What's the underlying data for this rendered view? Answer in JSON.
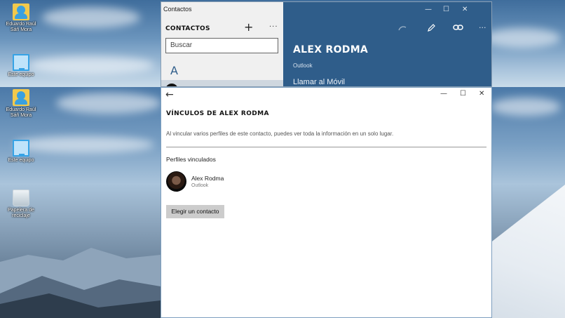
{
  "desktop": {
    "icons_top": [
      {
        "label": "Eduardo Raúl Sáñ Mora",
        "icon": "user-folder-icon"
      },
      {
        "label": "Este equipo",
        "icon": "computer-icon"
      }
    ],
    "icons_bottom": [
      {
        "label": "Eduardo Raúl Sáñ Mora",
        "icon": "user-folder-icon"
      },
      {
        "label": "Este equipo",
        "icon": "computer-icon"
      },
      {
        "label": "Papelera de reciclaje",
        "icon": "recycle-bin-icon"
      }
    ]
  },
  "contacts_window": {
    "title": "Contactos",
    "list_heading": "CONTACTOS",
    "add_symbol": "+",
    "more_symbol": "···",
    "search_placeholder": "Buscar",
    "group_letter": "A",
    "detail": {
      "name": "ALEX RODMA",
      "source": "Outlook",
      "call_action": "Llamar al Móvil",
      "more_symbol": "···"
    },
    "controls": {
      "minimize": "—",
      "maximize": "☐",
      "close": "✕"
    }
  },
  "links_window": {
    "back_symbol": "←",
    "controls": {
      "minimize": "—",
      "maximize": "☐",
      "close": "✕"
    },
    "title": "VÍNCULOS DE ALEX RODMA",
    "description": "Al vincular varios perfiles de este contacto, puedes ver toda la información en un solo lugar.",
    "section_label": "Perfiles vinculados",
    "linked_profiles": [
      {
        "name": "Alex Rodma",
        "source": "Outlook"
      }
    ],
    "choose_button": "Elegir un contacto"
  },
  "colors": {
    "accent": "#2f5d8a",
    "button_gray": "#cccccc"
  }
}
